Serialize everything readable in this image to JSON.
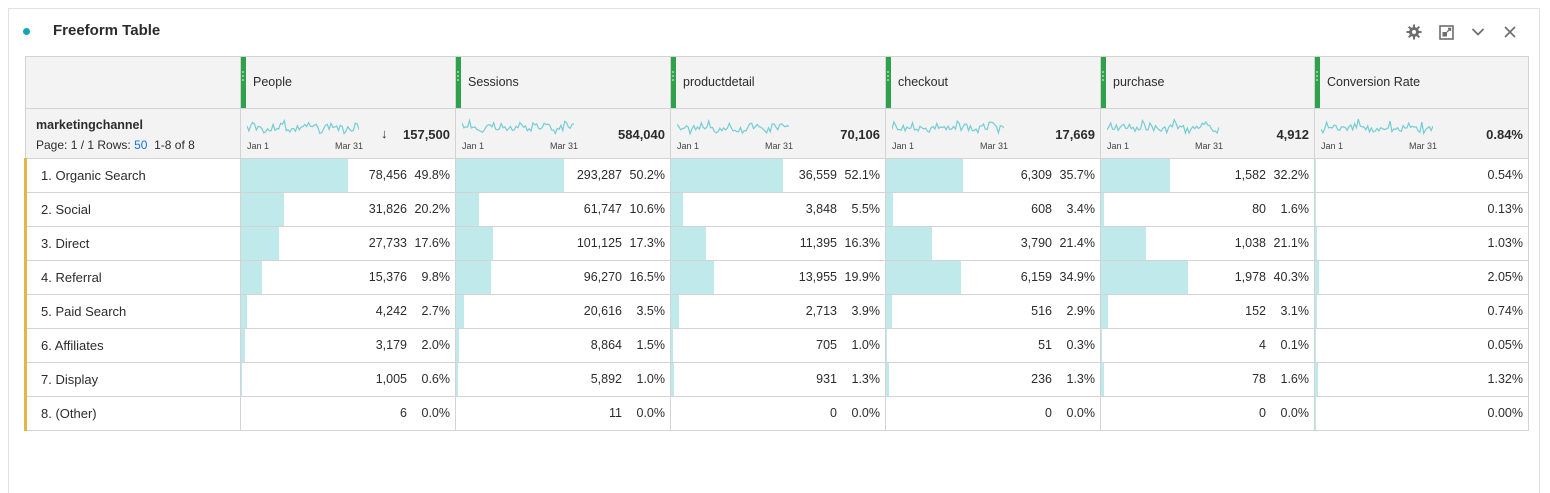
{
  "panel": {
    "title": "Freeform Table"
  },
  "colors": {
    "accent": "#15a5b6",
    "bar": "#bfe9eb",
    "metric_grip": "#2ea24a",
    "dim_grip": "#e5b647",
    "link": "#1473e6"
  },
  "icons": [
    "gear-icon",
    "expand-icon",
    "chevron-down-icon",
    "close-icon"
  ],
  "dimension": {
    "name": "marketingchannel",
    "page_label": "Page: 1 / 1",
    "rows_label": "Rows:",
    "rows_value": "50",
    "range": "1-8 of 8"
  },
  "spark_axis": {
    "start": "Jan 1",
    "end": "Mar 31"
  },
  "sort_arrow": "↓",
  "metrics": [
    {
      "name": "People",
      "total": "157,500",
      "sorted": true
    },
    {
      "name": "Sessions",
      "total": "584,040"
    },
    {
      "name": "productdetail",
      "total": "70,106"
    },
    {
      "name": "checkout",
      "total": "17,669"
    },
    {
      "name": "purchase",
      "total": "4,912"
    },
    {
      "name": "Conversion Rate",
      "total": "0.84%"
    }
  ],
  "rows": [
    {
      "label": "1. Organic Search",
      "cells": [
        {
          "value": "78,456",
          "pct": "49.8%",
          "share": 0.498
        },
        {
          "value": "293,287",
          "pct": "50.2%",
          "share": 0.502
        },
        {
          "value": "36,559",
          "pct": "52.1%",
          "share": 0.521
        },
        {
          "value": "6,309",
          "pct": "35.7%",
          "share": 0.357
        },
        {
          "value": "1,582",
          "pct": "32.2%",
          "share": 0.322
        }
      ],
      "conversion": {
        "value": "0.54%",
        "share": 0.0054
      }
    },
    {
      "label": "2. Social",
      "cells": [
        {
          "value": "31,826",
          "pct": "20.2%",
          "share": 0.202
        },
        {
          "value": "61,747",
          "pct": "10.6%",
          "share": 0.106
        },
        {
          "value": "3,848",
          "pct": "5.5%",
          "share": 0.055
        },
        {
          "value": "608",
          "pct": "3.4%",
          "share": 0.034
        },
        {
          "value": "80",
          "pct": "1.6%",
          "share": 0.016
        }
      ],
      "conversion": {
        "value": "0.13%",
        "share": 0.0013
      }
    },
    {
      "label": "3. Direct",
      "cells": [
        {
          "value": "27,733",
          "pct": "17.6%",
          "share": 0.176
        },
        {
          "value": "101,125",
          "pct": "17.3%",
          "share": 0.173
        },
        {
          "value": "11,395",
          "pct": "16.3%",
          "share": 0.163
        },
        {
          "value": "3,790",
          "pct": "21.4%",
          "share": 0.214
        },
        {
          "value": "1,038",
          "pct": "21.1%",
          "share": 0.211
        }
      ],
      "conversion": {
        "value": "1.03%",
        "share": 0.0103
      }
    },
    {
      "label": "4. Referral",
      "cells": [
        {
          "value": "15,376",
          "pct": "9.8%",
          "share": 0.098
        },
        {
          "value": "96,270",
          "pct": "16.5%",
          "share": 0.165
        },
        {
          "value": "13,955",
          "pct": "19.9%",
          "share": 0.199
        },
        {
          "value": "6,159",
          "pct": "34.9%",
          "share": 0.349
        },
        {
          "value": "1,978",
          "pct": "40.3%",
          "share": 0.403
        }
      ],
      "conversion": {
        "value": "2.05%",
        "share": 0.0205
      }
    },
    {
      "label": "5. Paid Search",
      "cells": [
        {
          "value": "4,242",
          "pct": "2.7%",
          "share": 0.027
        },
        {
          "value": "20,616",
          "pct": "3.5%",
          "share": 0.035
        },
        {
          "value": "2,713",
          "pct": "3.9%",
          "share": 0.039
        },
        {
          "value": "516",
          "pct": "2.9%",
          "share": 0.029
        },
        {
          "value": "152",
          "pct": "3.1%",
          "share": 0.031
        }
      ],
      "conversion": {
        "value": "0.74%",
        "share": 0.0074
      }
    },
    {
      "label": "6. Affiliates",
      "cells": [
        {
          "value": "3,179",
          "pct": "2.0%",
          "share": 0.02
        },
        {
          "value": "8,864",
          "pct": "1.5%",
          "share": 0.015
        },
        {
          "value": "705",
          "pct": "1.0%",
          "share": 0.01
        },
        {
          "value": "51",
          "pct": "0.3%",
          "share": 0.003
        },
        {
          "value": "4",
          "pct": "0.1%",
          "share": 0.001
        }
      ],
      "conversion": {
        "value": "0.05%",
        "share": 0.0005
      }
    },
    {
      "label": "7. Display",
      "cells": [
        {
          "value": "1,005",
          "pct": "0.6%",
          "share": 0.006
        },
        {
          "value": "5,892",
          "pct": "1.0%",
          "share": 0.01
        },
        {
          "value": "931",
          "pct": "1.3%",
          "share": 0.013
        },
        {
          "value": "236",
          "pct": "1.3%",
          "share": 0.013
        },
        {
          "value": "78",
          "pct": "1.6%",
          "share": 0.016
        }
      ],
      "conversion": {
        "value": "1.32%",
        "share": 0.0132
      }
    },
    {
      "label": "8. (Other)",
      "cells": [
        {
          "value": "6",
          "pct": "0.0%",
          "share": 0.0
        },
        {
          "value": "11",
          "pct": "0.0%",
          "share": 0.0
        },
        {
          "value": "0",
          "pct": "0.0%",
          "share": 0.0
        },
        {
          "value": "0",
          "pct": "0.0%",
          "share": 0.0
        },
        {
          "value": "0",
          "pct": "0.0%",
          "share": 0.0
        }
      ],
      "conversion": {
        "value": "0.00%",
        "share": 0.0
      }
    }
  ]
}
